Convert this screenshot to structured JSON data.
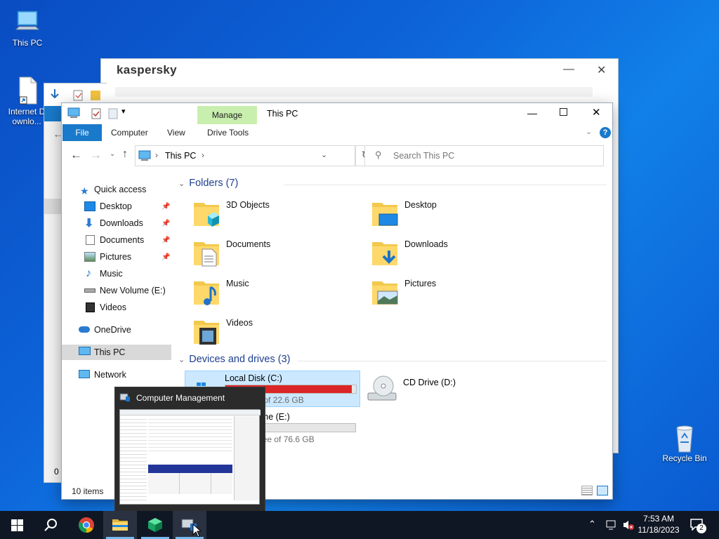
{
  "desktop": {
    "icons": [
      {
        "label": "This PC",
        "icon": "computer-icon"
      },
      {
        "label": "Internet Downlo...",
        "icon": "shortcut-file-icon"
      },
      {
        "label": "Recycle Bin",
        "icon": "recycle-bin-icon"
      }
    ]
  },
  "kaspersky": {
    "title": "kaspersky",
    "minimize": "—",
    "close": "✕"
  },
  "explorer": {
    "title": "This PC",
    "qat_icons": [
      "computer-icon",
      "properties-icon",
      "new-folder-icon",
      "dropdown-icon"
    ],
    "context_tab": "Manage",
    "tabs": {
      "file": "File",
      "computer": "Computer",
      "view": "View",
      "drive_tools": "Drive Tools"
    },
    "address": {
      "location": "This PC",
      "separator": "›"
    },
    "search": {
      "placeholder": "Search This PC"
    },
    "nav": [
      {
        "label": "Quick access",
        "icon": "star-icon"
      },
      {
        "label": "Desktop",
        "icon": "desktop-icon",
        "pinned": true
      },
      {
        "label": "Downloads",
        "icon": "download-arrow-icon",
        "pinned": true
      },
      {
        "label": "Documents",
        "icon": "documents-icon",
        "pinned": true
      },
      {
        "label": "Pictures",
        "icon": "pictures-icon",
        "pinned": true
      },
      {
        "label": "Music",
        "icon": "music-icon"
      },
      {
        "label": "New Volume (E:)",
        "icon": "drive-icon"
      },
      {
        "label": "Videos",
        "icon": "videos-icon"
      },
      {
        "label": "OneDrive",
        "icon": "cloud-icon"
      },
      {
        "label": "This PC",
        "icon": "computer-icon",
        "selected": true
      },
      {
        "label": "Network",
        "icon": "network-icon"
      }
    ],
    "folders_header": "Folders (7)",
    "folders": [
      {
        "label": "3D Objects",
        "icon": "3d-objects-folder-icon"
      },
      {
        "label": "Desktop",
        "icon": "desktop-folder-icon"
      },
      {
        "label": "Documents",
        "icon": "documents-folder-icon"
      },
      {
        "label": "Downloads",
        "icon": "downloads-folder-icon"
      },
      {
        "label": "Music",
        "icon": "music-folder-icon"
      },
      {
        "label": "Pictures",
        "icon": "pictures-folder-icon"
      },
      {
        "label": "Videos",
        "icon": "videos-folder-icon"
      }
    ],
    "drives_header": "Devices and drives (3)",
    "drives": [
      {
        "label": "Local Disk (C:)",
        "free": "0 MB free of 22.6 GB",
        "used_fraction": 0.97,
        "color": "#da2626"
      },
      {
        "label": "CD Drive (D:)"
      },
      {
        "label": "New Volume (E:)",
        "free": "76.6 GB free of 76.6 GB",
        "used_fraction": 0.0,
        "color": "#26a0da"
      }
    ],
    "status": "10 items"
  },
  "thumbnail": {
    "title": "Computer Management"
  },
  "taskbar": {
    "apps": [
      "start-icon",
      "search-icon",
      "chrome-icon",
      "file-explorer-icon",
      "cube-app-icon",
      "computer-management-icon"
    ],
    "time": "7:53 AM",
    "date": "11/18/2023",
    "notification_count": "2"
  }
}
